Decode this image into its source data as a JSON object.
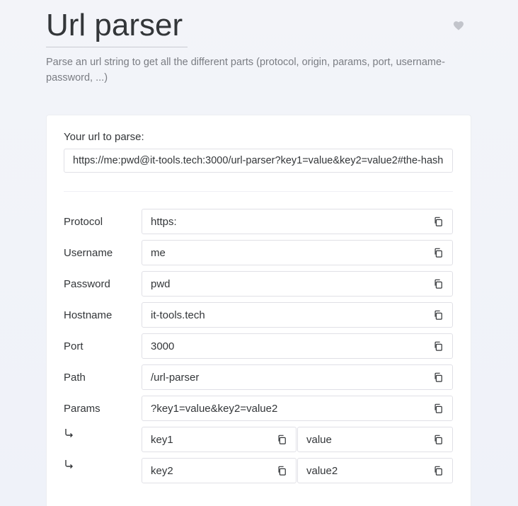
{
  "header": {
    "title": "Url parser",
    "description": "Parse an url string to get all the different parts (protocol, origin, params, port, username-password, ...)",
    "favorite_icon": "heart-icon"
  },
  "form": {
    "url_label": "Your url to parse:",
    "url_value": "https://me:pwd@it-tools.tech:3000/url-parser?key1=value&key2=value2#the-hash"
  },
  "fields": [
    {
      "label": "Protocol",
      "value": "https:"
    },
    {
      "label": "Username",
      "value": "me"
    },
    {
      "label": "Password",
      "value": "pwd"
    },
    {
      "label": "Hostname",
      "value": "it-tools.tech"
    },
    {
      "label": "Port",
      "value": "3000"
    },
    {
      "label": "Path",
      "value": "/url-parser"
    },
    {
      "label": "Params",
      "value": "?key1=value&key2=value2"
    }
  ],
  "params": [
    {
      "key": "key1",
      "value": "value"
    },
    {
      "key": "key2",
      "value": "value2"
    }
  ],
  "icons": {
    "copy": "copy-icon",
    "sub_param": "arrow-return-icon"
  },
  "colors": {
    "background": "#f1f3f9",
    "card": "#ffffff",
    "text": "#333639",
    "muted": "#7a7d83",
    "border": "#e0e0e6"
  }
}
